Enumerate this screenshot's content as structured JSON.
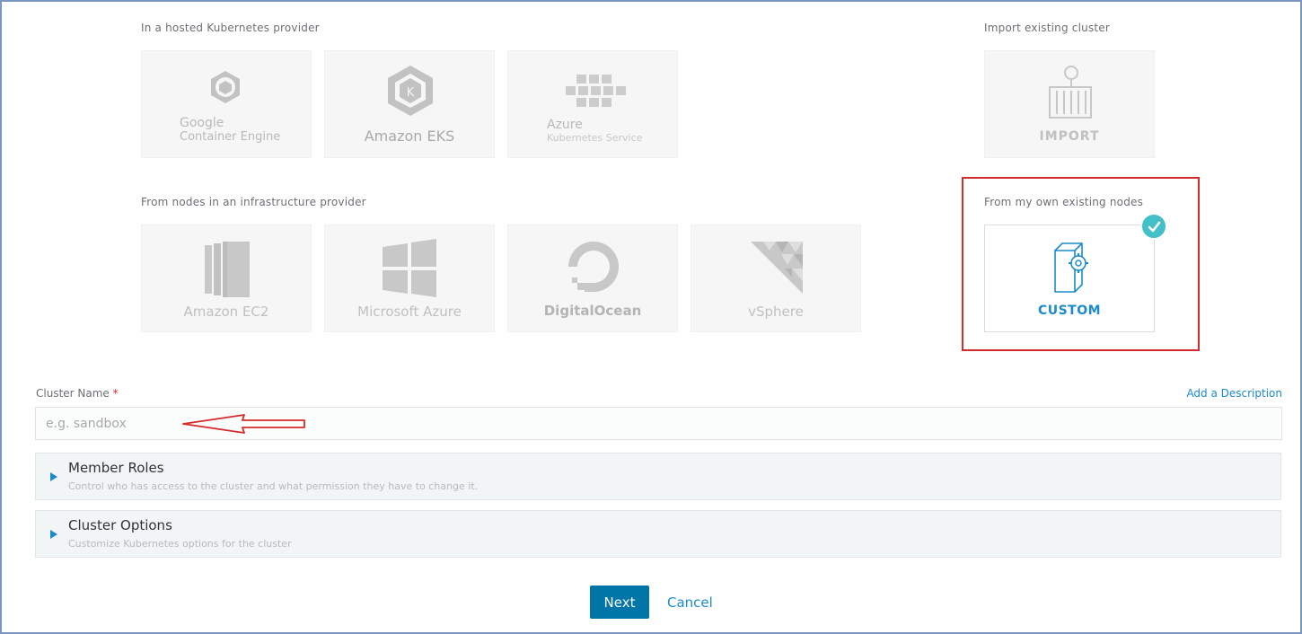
{
  "hosted": {
    "label": "In a hosted Kubernetes provider",
    "tiles": [
      {
        "line1": "Google",
        "line2": "Container Engine"
      },
      {
        "name": "Amazon EKS"
      },
      {
        "line1": "Azure",
        "line2": "Kubernetes Service"
      }
    ]
  },
  "import": {
    "label": "Import existing cluster",
    "tile": {
      "name": "IMPORT"
    }
  },
  "infra": {
    "label": "From nodes in an infrastructure provider",
    "tiles": [
      {
        "name": "Amazon EC2"
      },
      {
        "name": "Microsoft Azure"
      },
      {
        "name": "DigitalOcean"
      },
      {
        "name": "vSphere"
      }
    ]
  },
  "own": {
    "label": "From my own existing nodes",
    "tile": {
      "name": "CUSTOM"
    }
  },
  "cluster_name": {
    "label": "Cluster Name",
    "required_mark": "*",
    "placeholder": "e.g. sandbox",
    "value": "",
    "add_description": "Add a Description"
  },
  "sections": [
    {
      "title": "Member Roles",
      "subtitle": "Control who has access to the cluster and what permission they have to change it."
    },
    {
      "title": "Cluster Options",
      "subtitle": "Customize Kubernetes options for the cluster"
    }
  ],
  "footer": {
    "next": "Next",
    "cancel": "Cancel"
  },
  "colors": {
    "accent": "#1b8bc9",
    "primary_button": "#0075a8",
    "check": "#43c0c7",
    "highlight_box": "#d32b2b"
  }
}
